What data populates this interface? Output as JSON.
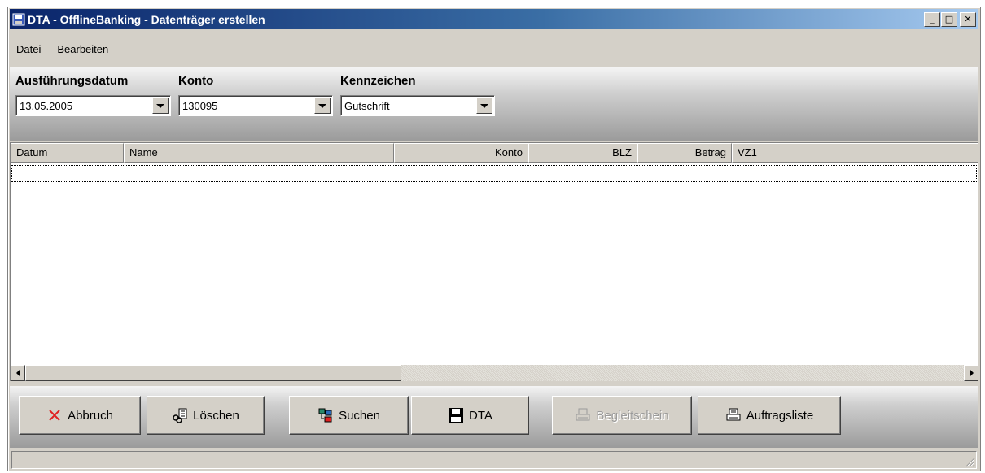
{
  "window": {
    "title": "DTA - OfflineBanking - Datenträger erstellen",
    "minimize_glyph": "_",
    "maximize_glyph": "□",
    "close_glyph": "✕"
  },
  "menu": {
    "items": [
      {
        "label": "Datei",
        "accel": "D",
        "rest": "atei"
      },
      {
        "label": "Bearbeiten",
        "accel": "B",
        "rest": "earbeiten"
      }
    ]
  },
  "filters": {
    "date": {
      "label": "Ausführungsdatum",
      "value": "13.05.2005"
    },
    "account": {
      "label": "Konto",
      "value": "130095"
    },
    "flag": {
      "label": "Kennzeichen",
      "value": "Gutschrift"
    }
  },
  "table": {
    "columns": [
      "Datum",
      "Name",
      "Konto",
      "BLZ",
      "Betrag",
      "VZ1"
    ],
    "rows": []
  },
  "buttons": {
    "abort": {
      "label": "Abbruch",
      "icon": "x-icon"
    },
    "delete": {
      "label": "Löschen",
      "icon": "delete-icon"
    },
    "search": {
      "label": "Suchen",
      "icon": "search-icon"
    },
    "dta": {
      "label": "DTA",
      "icon": "floppy-disk-icon"
    },
    "cover": {
      "label": "Begleitschein",
      "icon": "printer-icon",
      "disabled": true
    },
    "orders": {
      "label": "Auftragsliste",
      "icon": "printer-icon"
    }
  },
  "colors": {
    "title_gradient_start": "#0a246a",
    "title_gradient_end": "#a6caf0",
    "face": "#d4d0c8",
    "abort_red": "#e02020"
  }
}
